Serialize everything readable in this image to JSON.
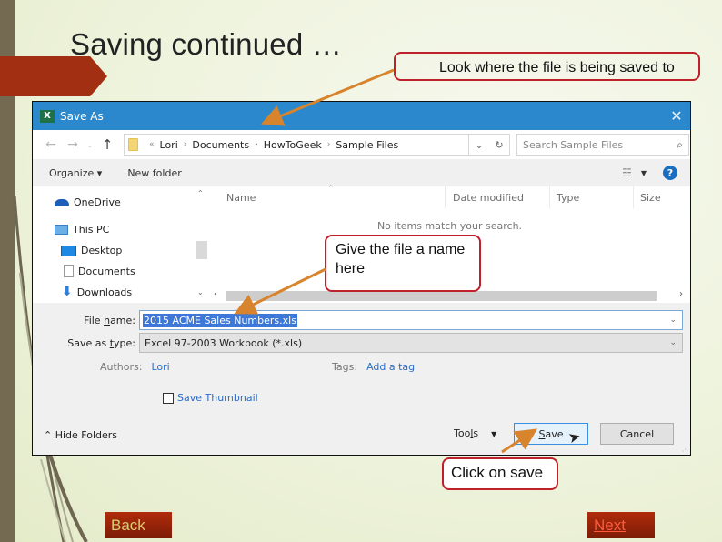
{
  "slide": {
    "title": "Saving continued …",
    "callouts": {
      "location": "Look where the file is being saved to",
      "filename": "Give the file a name here",
      "save": "Click on save"
    },
    "nav": {
      "back": "Back",
      "next": "Next"
    },
    "colors": {
      "accent_red": "#a32f12",
      "callout_border": "#c0202a",
      "arrow": "#d8842c",
      "bar": "#746a52"
    }
  },
  "dialog": {
    "title": "Save As",
    "app_icon": "excel-icon",
    "close_glyph": "✕",
    "address": {
      "overflow": "«",
      "crumbs": [
        "Lori",
        "Documents",
        "HowToGeek",
        "Sample Files"
      ],
      "separator": "›"
    },
    "search_placeholder": "Search Sample Files",
    "toolbar": {
      "organize": "Organize ▾",
      "new_folder": "New folder"
    },
    "nav_pane": {
      "items": [
        {
          "label": "OneDrive",
          "icon": "onedrive-icon"
        },
        {
          "label": "This PC",
          "icon": "computer-icon"
        },
        {
          "label": "Desktop",
          "icon": "desktop-icon"
        },
        {
          "label": "Documents",
          "icon": "documents-icon"
        },
        {
          "label": "Downloads",
          "icon": "downloads-icon"
        }
      ]
    },
    "file_list": {
      "columns": [
        "Name",
        "Date modified",
        "Type",
        "Size"
      ],
      "empty_message": "No items match your search."
    },
    "form": {
      "file_name_label_pre": "File ",
      "file_name_label_u": "n",
      "file_name_label_post": "ame:",
      "file_name_value": "2015 ACME Sales Numbers.xls",
      "save_type_label_pre": "Save as ",
      "save_type_label_u": "t",
      "save_type_label_post": "ype:",
      "save_type_value": "Excel 97-2003 Workbook (*.xls)",
      "authors_label": "Authors:",
      "authors_value": "Lori",
      "tags_label": "Tags:",
      "tags_value": "Add a tag",
      "save_thumbnail": "Save Thumbnail",
      "save_thumbnail_checked": false
    },
    "footer": {
      "hide_folders": "Hide Folders",
      "tools_pre": "Too",
      "tools_u": "l",
      "tools_post": "s",
      "save_u": "S",
      "save_rest": "ave",
      "cancel": "Cancel"
    }
  }
}
